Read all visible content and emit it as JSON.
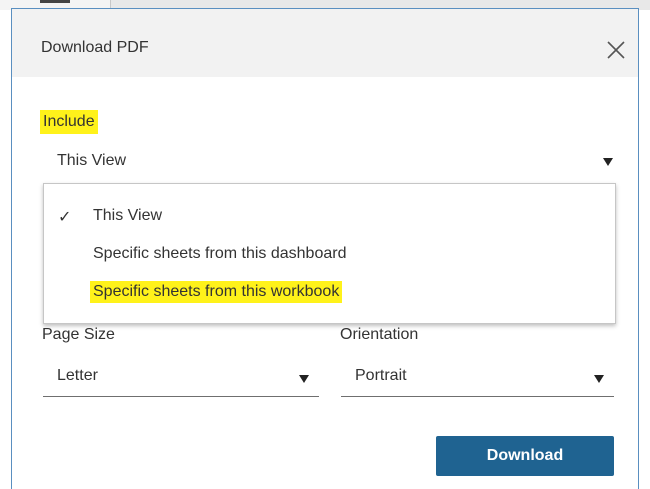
{
  "dialog": {
    "title": "Download PDF",
    "close_icon": "close-icon"
  },
  "include": {
    "label": "Include",
    "selected": "This View",
    "options": [
      {
        "label": "This View",
        "checked": true,
        "highlighted": false
      },
      {
        "label": "Specific sheets from this dashboard",
        "checked": false,
        "highlighted": false
      },
      {
        "label": "Specific sheets from this workbook",
        "checked": false,
        "highlighted": true
      }
    ],
    "check_glyph": "✓"
  },
  "page_size": {
    "label": "Page Size",
    "value": "Letter"
  },
  "orientation": {
    "label": "Orientation",
    "value": "Portrait"
  },
  "download_button": {
    "label": "Download"
  },
  "colors": {
    "highlight": "#fff21a",
    "primary_button": "#1f6391",
    "dialog_border": "#5a8fc0",
    "header_bg": "#f2f2f2"
  }
}
